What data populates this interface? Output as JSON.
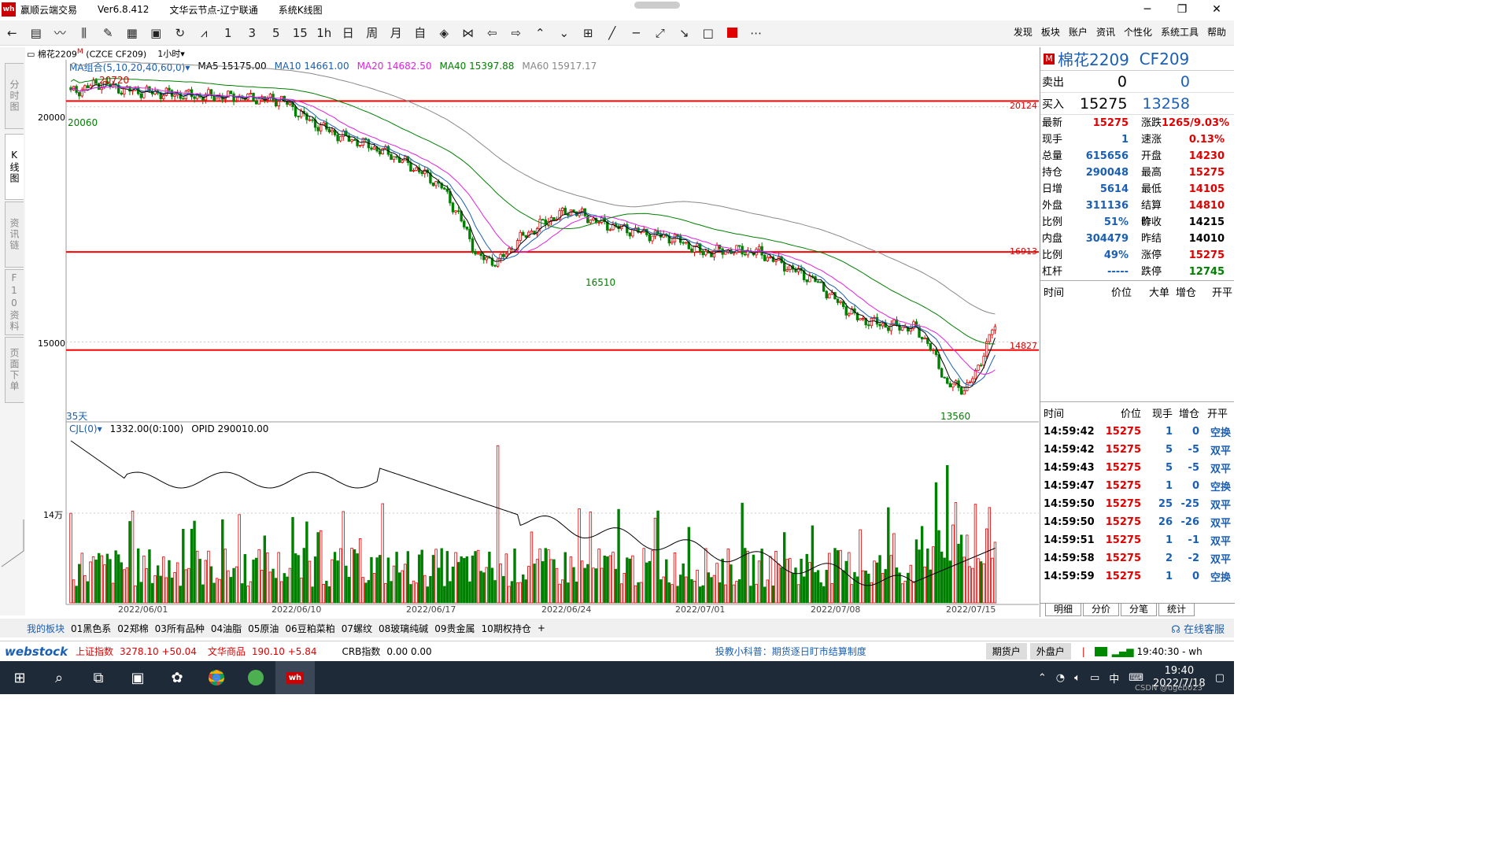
{
  "window": {
    "app_name": "赢顺云端交易",
    "version": "Ver6.8.412",
    "node": "文华云节点-辽宁联通",
    "view": "系统K线图",
    "logo_text": "wh"
  },
  "toolbar": {
    "icons": [
      "back-icon",
      "grid-icon",
      "line-chart-icon",
      "candle-icon",
      "draw-icon",
      "table-icon",
      "save-icon",
      "refresh-icon",
      "indicator-icon"
    ],
    "periods": [
      "1",
      "3",
      "5",
      "15",
      "1h",
      "日",
      "周",
      "月",
      "自"
    ],
    "menu": [
      "发现",
      "板块",
      "账户",
      "资讯",
      "个性化",
      "系统工具",
      "帮助"
    ]
  },
  "side_tabs": [
    "分时图",
    "K线图",
    "资讯链",
    "F10资料",
    "页面下单"
  ],
  "chart_header": {
    "symbol": "棉花2209",
    "symbol_sup": "M",
    "code": "(CZCE CF209)",
    "period": "1小时"
  },
  "ma_line": {
    "label": "MA组合(5,10,20,40,60,0)",
    "ma5": "MA5 15175.00",
    "ma10": "MA10 14661.00",
    "ma20": "MA20 14682.50",
    "ma40": "MA40 15397.88",
    "ma60": "MA60 15917.17"
  },
  "colors": {
    "up": "#e00000",
    "down": "#008000",
    "ma5": "#000000",
    "ma10": "#1a5fb4",
    "ma20": "#e020e0",
    "ma40": "#008000",
    "ma60": "#888888",
    "hline": "#ff0000"
  },
  "chart_data": {
    "type": "candlestick",
    "y_ticks": [
      "20000",
      "15000"
    ],
    "h_lines": [
      {
        "value": 20124,
        "label": "20124"
      },
      {
        "value": 16913,
        "label": "16913"
      },
      {
        "value": 14827,
        "label": "14827"
      }
    ],
    "annotations": [
      {
        "text": "20720"
      },
      {
        "text": "20060"
      },
      {
        "text": "16510"
      },
      {
        "text": "13560"
      }
    ],
    "days_label": "35天",
    "x_labels": [
      "2022/06/01",
      "2022/06/10",
      "2022/06/17",
      "2022/06/24",
      "2022/07/01",
      "2022/07/08",
      "2022/07/15"
    ],
    "volume_header": {
      "label": "CJL(0)",
      "value": "1332.00(0:100)",
      "opid": "OPID 290010.00"
    },
    "volume_tick": "14万"
  },
  "quote": {
    "title": "棉花2209",
    "code": "CF209",
    "sell_label": "卖出",
    "sell_price": "0",
    "sell_vol": "0",
    "buy_label": "买入",
    "buy_price": "15275",
    "buy_vol": "13258",
    "rows": [
      {
        "l1": "最新",
        "v1": "15275",
        "c1": "red",
        "l2": "涨跌",
        "v2": "1265/9.03%",
        "c2": "red"
      },
      {
        "l1": "现手",
        "v1": "1",
        "c1": "blue",
        "l2": "速涨",
        "v2": "0.13%",
        "c2": "red"
      },
      {
        "l1": "总量",
        "v1": "615656",
        "c1": "blue",
        "l2": "开盘",
        "v2": "14230",
        "c2": "red"
      },
      {
        "l1": "持仓",
        "v1": "290048",
        "c1": "blue",
        "l2": "最高",
        "v2": "15275",
        "c2": "red"
      },
      {
        "l1": "日增",
        "v1": "5614",
        "c1": "blue",
        "l2": "最低",
        "v2": "14105",
        "c2": "red"
      },
      {
        "l1": "外盘",
        "v1": "311136",
        "c1": "blue",
        "l2": "结算价",
        "v2": "14810",
        "c2": "red"
      },
      {
        "l1": "比例",
        "v1": "51%",
        "c1": "blue",
        "l2": "昨收",
        "v2": "14215",
        "c2": "blk"
      },
      {
        "l1": "内盘",
        "v1": "304479",
        "c1": "blue",
        "l2": "昨结",
        "v2": "14010",
        "c2": "blk"
      },
      {
        "l1": "比例",
        "v1": "49%",
        "c1": "blue",
        "l2": "涨停",
        "v2": "15275",
        "c2": "red"
      },
      {
        "l1": "杠杆",
        "v1": "-----",
        "c1": "blue",
        "l2": "跌停",
        "v2": "12745",
        "c2": "green"
      }
    ],
    "big_header": [
      "时间",
      "价位",
      "大单",
      "增仓",
      "开平"
    ],
    "tick_header": [
      "时间",
      "价位",
      "现手",
      "增仓",
      "开平"
    ],
    "ticks": [
      {
        "t": "14:59:42",
        "p": "15275",
        "v": "1",
        "d": "0",
        "k": "空换"
      },
      {
        "t": "14:59:42",
        "p": "15275",
        "v": "5",
        "d": "-5",
        "k": "双平"
      },
      {
        "t": "14:59:43",
        "p": "15275",
        "v": "5",
        "d": "-5",
        "k": "双平"
      },
      {
        "t": "14:59:47",
        "p": "15275",
        "v": "1",
        "d": "0",
        "k": "空换"
      },
      {
        "t": "14:59:50",
        "p": "15275",
        "v": "25",
        "d": "-25",
        "k": "双平"
      },
      {
        "t": "14:59:50",
        "p": "15275",
        "v": "26",
        "d": "-26",
        "k": "双平"
      },
      {
        "t": "14:59:51",
        "p": "15275",
        "v": "1",
        "d": "-1",
        "k": "双平"
      },
      {
        "t": "14:59:58",
        "p": "15275",
        "v": "2",
        "d": "-2",
        "k": "双平"
      },
      {
        "t": "14:59:59",
        "p": "15275",
        "v": "1",
        "d": "0",
        "k": "空换"
      }
    ],
    "bottom_tabs": [
      "明细",
      "分价",
      "分笔",
      "统计"
    ]
  },
  "block_tabs": [
    "我的板块",
    "01黑色系",
    "02郑棉",
    "03所有品种",
    "04油脂",
    "05原油",
    "06豆粕菜粕",
    "07螺纹",
    "08玻璃纯碱",
    "09贵金属",
    "10期权持仓",
    "+"
  ],
  "customer_service": "在线客服",
  "status": {
    "brand": "webstock",
    "idx1_name": "上证指数",
    "idx1_val": "3278.10 +50.04",
    "idx2_name": "文华商品",
    "idx2_val": "190.10 +5.84",
    "idx3_name": "CRB指数",
    "idx3_val": "0.00 0.00",
    "tip": "投教小科普：期货逐日盯市结算制度",
    "btn1": "期货户",
    "btn2": "外盘户",
    "time": "19:40:30 - wh"
  },
  "taskbar": {
    "time": "19:40",
    "date": "2022/7/18",
    "ime": "中",
    "watermark": "CSDN @ugeb023"
  }
}
